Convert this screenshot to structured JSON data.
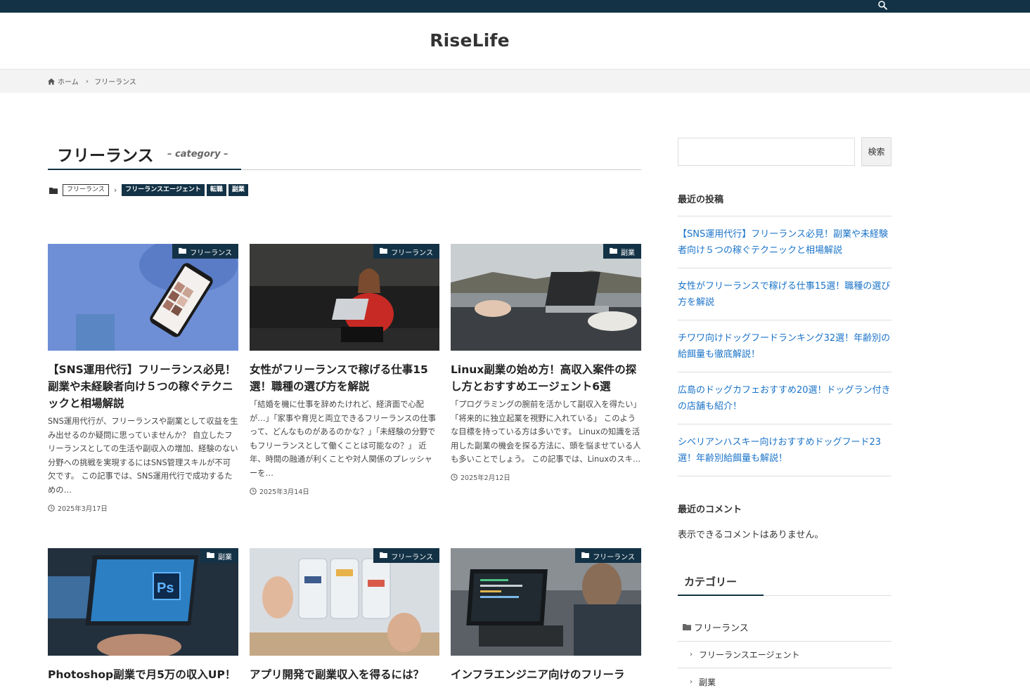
{
  "site": {
    "title": "RiseLife"
  },
  "breadcrumb": {
    "home": "ホーム",
    "current": "フリーランス"
  },
  "page": {
    "title": "フリーランス",
    "subtitle": "– category –"
  },
  "category_path": {
    "current": "フリーランス",
    "children": [
      "フリーランスエージェント",
      "転職",
      "副業"
    ]
  },
  "cards": [
    {
      "category": "フリーランス",
      "title": "【SNS運用代行】フリーランス必見！副業や未経験者向け５つの稼ぐテクニックと相場解説",
      "excerpt": "SNS運用代行が、フリーランスや副業として収益を生み出せるのか疑問に思っていませんか？ 自立したフリーランスとしての生活や副収入の増加、経験のない分野への挑戦を実現するにはSNS管理スキルが不可欠です。 この記事では、SNS運用代行で成功するための…",
      "date": "2025年3月17日"
    },
    {
      "category": "フリーランス",
      "title": "女性がフリーランスで稼げる仕事15選！職種の選び方を解説",
      "excerpt": "「結婚を機に仕事を辞めたけれど、経済面で心配が…」「家事や育児と両立できるフリーランスの仕事って、どんなものがあるのかな？」「未経験の分野でもフリーランスとして働くことは可能なの？」 近年、時間の融通が利くことや対人関係のプレッシャーを…",
      "date": "2025年3月14日"
    },
    {
      "category": "副業",
      "title": "Linux副業の始め方！高収入案件の探し方とおすすめエージェント6選",
      "excerpt": "「プログラミングの腕前を活かして副収入を得たい」「将来的に独立起業を視野に入れている」 このような目標を持っている方は多いです。 Linuxの知識を活用した副業の機会を探る方法に、頭を悩ませている人も多いことでしょう。 この記事では、Linuxのスキ…",
      "date": "2025年2月12日"
    },
    {
      "category": "副業",
      "title": "Photoshop副業で月5万の収入UP！"
    },
    {
      "category": "フリーランス",
      "title": "アプリ開発で副業収入を得るには？"
    },
    {
      "category": "フリーランス",
      "title": "インフラエンジニア向けのフリーラ"
    }
  ],
  "sidebar": {
    "search_button": "検索",
    "recent_posts_title": "最近の投稿",
    "recent_posts": [
      "【SNS運用代行】フリーランス必見！副業や未経験者向け５つの稼ぐテクニックと相場解説",
      "女性がフリーランスで稼げる仕事15選！職種の選び方を解説",
      "チワワ向けドッグフードランキング32選！年齢別の給餌量も徹底解説！",
      "広島のドッグカフェおすすめ20選！ドッグラン付きの店舗も紹介！",
      "シベリアンハスキー向けおすすめドッグフード23選！年齢別給餌量も解説！"
    ],
    "recent_comments_title": "最近のコメント",
    "no_comments": "表示できるコメントはありません。",
    "categories_title": "カテゴリー",
    "categories": {
      "parent": "フリーランス",
      "children": [
        "フリーランスエージェント",
        "副業"
      ]
    }
  },
  "icons": [
    "search-icon",
    "home-icon",
    "chevron-right-icon",
    "folder-icon",
    "clock-icon"
  ],
  "colors": {
    "accent": "#133246",
    "link": "#1a73c8"
  }
}
